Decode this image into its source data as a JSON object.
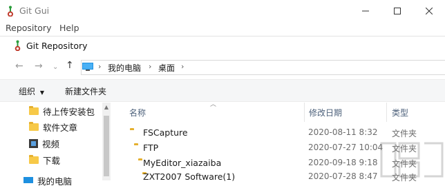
{
  "window": {
    "title": "Git Gui",
    "menu": [
      "Repository",
      "Help"
    ]
  },
  "dialog": {
    "title": "Git Repository",
    "breadcrumb": [
      "我的电脑",
      "桌面"
    ],
    "toolbar": {
      "organize": "组织",
      "new_folder": "新建文件夹"
    }
  },
  "sidebar": {
    "items": [
      {
        "label": "待上传安装包",
        "icon": "folder-icon"
      },
      {
        "label": "软件文章",
        "icon": "folder-icon"
      },
      {
        "label": "视频",
        "icon": "video-icon"
      },
      {
        "label": "下载",
        "icon": "folder-icon"
      },
      {
        "label": "我的电脑",
        "icon": "computer-icon"
      }
    ]
  },
  "files": {
    "columns": {
      "name": "名称",
      "date": "修改日期",
      "type": "类型"
    },
    "rows": [
      {
        "name": "FSCapture",
        "date": "2020-08-11 8:32",
        "type": "文件夹"
      },
      {
        "name": "FTP",
        "date": "2020-07-27 10:04",
        "type": "文件夹"
      },
      {
        "name": "MyEditor_xiazaiba",
        "date": "2020-09-18 9:18",
        "type": "文件夹"
      },
      {
        "name": "ZXT2007 Software(1)",
        "date": "2020-07-28 8:47",
        "type": "文件夹"
      }
    ]
  },
  "colors": {
    "folder": "#f7c948",
    "header_text": "#4c607a",
    "cmdbar": "#f5f6f7"
  }
}
